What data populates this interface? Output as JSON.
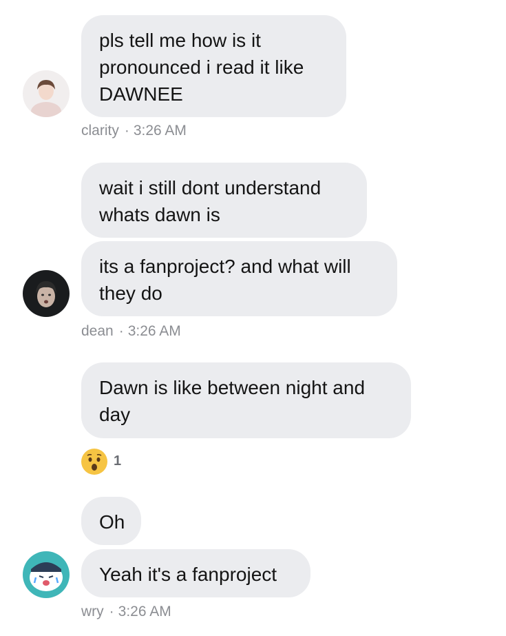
{
  "messages": [
    {
      "text": "pls tell me how is it\npronounced i read it like\nDAWNEE"
    },
    {
      "text": "wait i still dont understand\nwhats dawn is"
    },
    {
      "text": "its a fanproject? and what will\nthey do"
    },
    {
      "text": "Dawn is like between night and\nday"
    },
    {
      "text": "Oh"
    },
    {
      "text": "Yeah it's a fanproject"
    }
  ],
  "groups": [
    {
      "sender": "clarity",
      "separator": "·",
      "time": "3:26 AM",
      "avatar": "avatar-clarity"
    },
    {
      "sender": "dean",
      "separator": "·",
      "time": "3:26 AM",
      "avatar": "avatar-dean"
    },
    {
      "sender": "wry",
      "separator": "·",
      "time": "3:26 AM",
      "avatar": "avatar-wry"
    }
  ],
  "reaction": {
    "emoji": "surprised-face-icon",
    "count": "1"
  },
  "colors": {
    "bubble": "#ebecef",
    "meta_text": "#8b8d92",
    "text": "#141414",
    "emoji": "#f6c443"
  }
}
